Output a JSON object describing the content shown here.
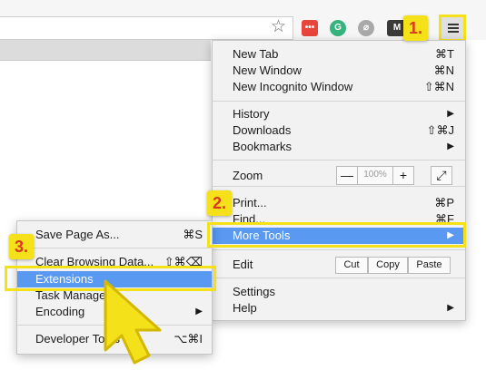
{
  "toolbar": {
    "extension_icons": [
      "adblock-icon",
      "grammarly-icon",
      "disable-icon",
      "m-extension-icon"
    ],
    "ext_glyphs": [
      "•••",
      "G",
      "⌀",
      "M"
    ]
  },
  "main_menu": {
    "new_tab": "New Tab",
    "new_tab_sc": "⌘T",
    "new_window": "New Window",
    "new_window_sc": "⌘N",
    "new_incognito": "New Incognito Window",
    "new_incognito_sc": "⇧⌘N",
    "history": "History",
    "downloads": "Downloads",
    "downloads_sc": "⇧⌘J",
    "bookmarks": "Bookmarks",
    "zoom": "Zoom",
    "zoom_minus": "—",
    "zoom_value": "100%",
    "zoom_plus": "+",
    "fullscreen": "⤢",
    "print": "Print...",
    "print_sc": "⌘P",
    "find": "Find...",
    "find_sc": "⌘F",
    "more_tools": "More Tools",
    "edit": "Edit",
    "cut": "Cut",
    "copy": "Copy",
    "paste": "Paste",
    "settings": "Settings",
    "help": "Help"
  },
  "sub_menu": {
    "save_page": "Save Page As...",
    "save_page_sc": "⌘S",
    "clear_browsing": "Clear Browsing Data...",
    "clear_browsing_sc": "⇧⌘⌫",
    "extensions": "Extensions",
    "task_manager": "Task Manager",
    "encoding": "Encoding",
    "developer_tools": "Developer Tools",
    "developer_tools_sc": "⌥⌘I"
  },
  "annotations": {
    "step1": "1.",
    "step2": "2.",
    "step3": "3."
  },
  "colors": {
    "highlight": "#5a99f2",
    "callout": "#f5e11a",
    "callout_text": "#d9381e"
  }
}
